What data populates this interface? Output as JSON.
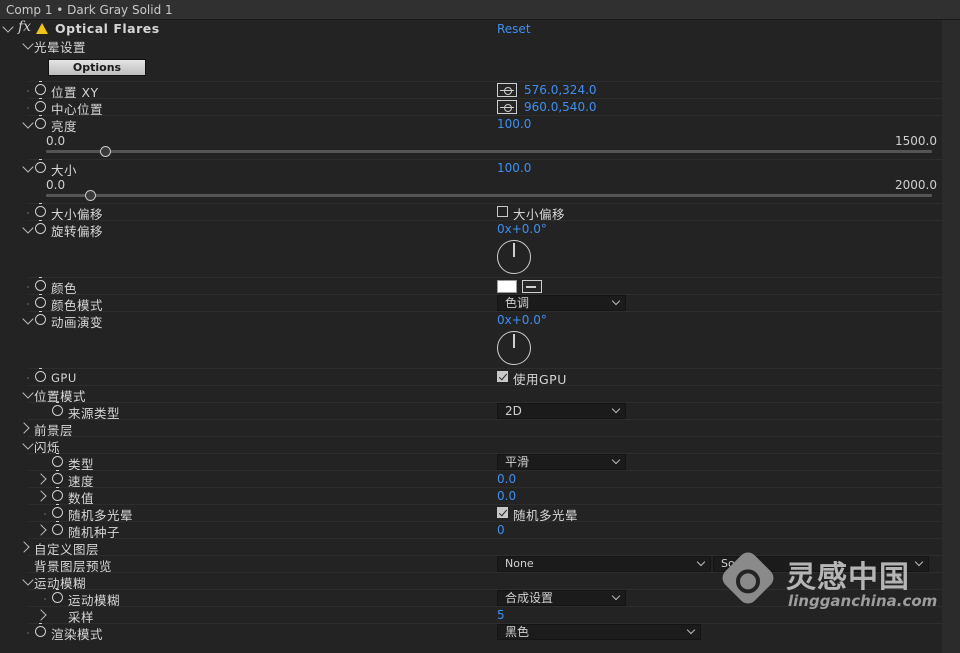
{
  "header": {
    "comp_title": "Comp 1 • Dark Gray Solid 1"
  },
  "effect": {
    "name": "Optical Flares",
    "reset_label": "Reset"
  },
  "flare_settings": {
    "label": "光晕设置",
    "options_button": "Options"
  },
  "position_xy": {
    "label": "位置 XY",
    "value": "576.0,324.0"
  },
  "center_position": {
    "label": "中心位置",
    "value": "960.0,540.0"
  },
  "brightness": {
    "label": "亮度",
    "value": "100.0",
    "min": "0.0",
    "max": "1500.0",
    "slider_fraction": 0.0667
  },
  "size": {
    "label": "大小",
    "value": "100.0",
    "min": "0.0",
    "max": "2000.0",
    "slider_fraction": 0.05
  },
  "size_offset": {
    "label": "大小偏移",
    "checkbox_label": "大小偏移",
    "checked": false
  },
  "rotation_offset": {
    "label": "旋转偏移",
    "value": "0x+0.0°"
  },
  "color": {
    "label": "颜色",
    "swatch": "#ffffff"
  },
  "color_mode": {
    "label": "颜色模式",
    "selected": "色调"
  },
  "animation_evolution": {
    "label": "动画演变",
    "value": "0x+0.0°"
  },
  "gpu": {
    "label": "GPU",
    "checkbox_label": "使用GPU",
    "checked": true
  },
  "position_mode": {
    "label": "位置模式",
    "source_type_label": "来源类型",
    "source_type_selected": "2D"
  },
  "foreground_layers": {
    "label": "前景层"
  },
  "flicker": {
    "label": "闪烁",
    "type_label": "类型",
    "type_selected": "平滑",
    "speed_label": "速度",
    "speed_value": "0.0",
    "amount_label": "数值",
    "amount_value": "0.0",
    "random_label": "随机多光晕",
    "random_checkbox_label": "随机多光晕",
    "random_checked": true,
    "seed_label": "随机种子",
    "seed_value": "0"
  },
  "custom_layer": {
    "label": "自定义图层"
  },
  "bg_preview": {
    "label": "背景图层预览",
    "layer_selected": "None",
    "source_selected": "Source"
  },
  "motion_blur": {
    "label": "运动模糊",
    "mb_label": "运动模糊",
    "mb_selected": "合成设置",
    "samples_label": "采样",
    "samples_value": "5"
  },
  "render_mode": {
    "label": "渲染模式",
    "selected": "黑色"
  },
  "watermark": {
    "brand": "灵感中国",
    "url": "lingganchina.com"
  },
  "colors": {
    "value_blue": "#3f8ff0",
    "background": "#232323",
    "warning": "#f0c419"
  }
}
